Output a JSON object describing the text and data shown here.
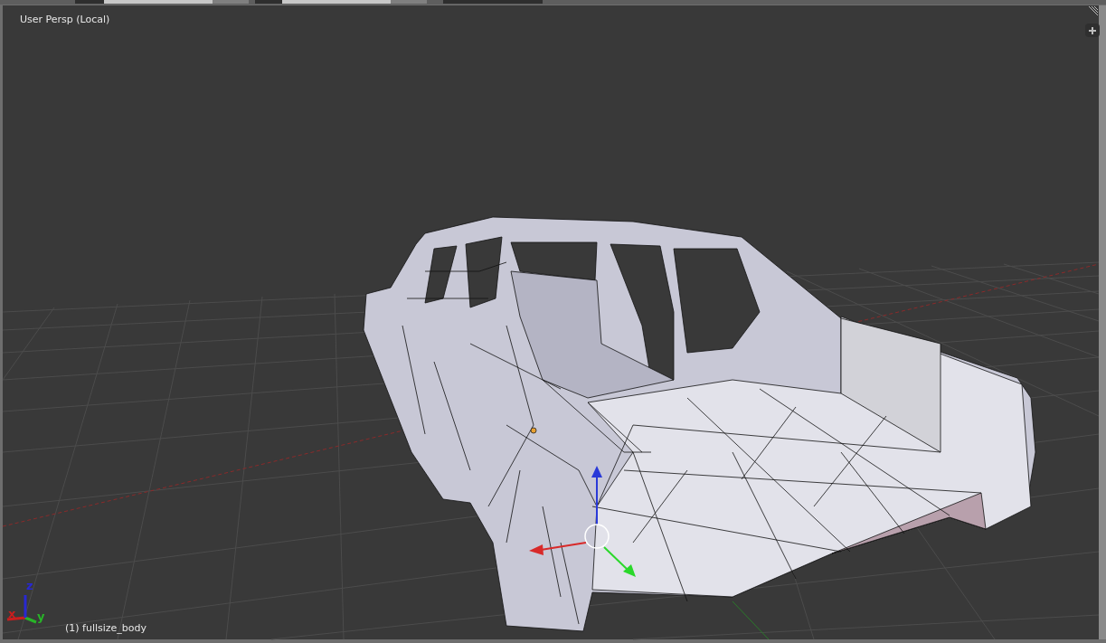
{
  "viewport": {
    "view_label": "User Persp (Local)",
    "object_label": "(1) fullsize_body",
    "axes": [
      {
        "label": "x",
        "color": "#c81e1e"
      },
      {
        "label": "y",
        "color": "#28b428"
      },
      {
        "label": "z",
        "color": "#2828d2"
      }
    ]
  }
}
